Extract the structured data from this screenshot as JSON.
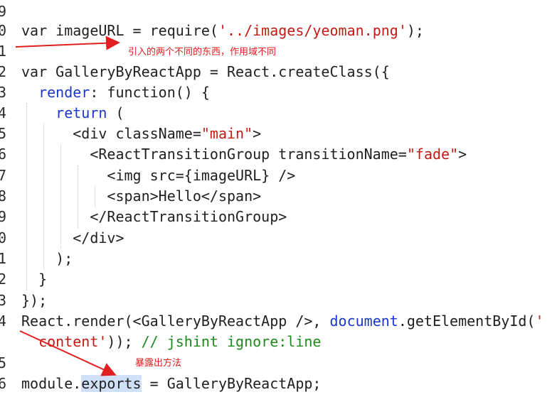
{
  "lines": [
    {
      "num": "9",
      "tokens": []
    },
    {
      "num": "0",
      "tokens": [
        {
          "t": "var imageURL = require(",
          "c": "var"
        },
        {
          "t": "'../images/yeoman.png'",
          "c": "str"
        },
        {
          "t": ");",
          "c": "punct"
        }
      ]
    },
    {
      "num": "1",
      "tokens": []
    },
    {
      "num": "2",
      "tokens": [
        {
          "t": "var GalleryByReactApp = React.createClass({",
          "c": "var"
        }
      ]
    },
    {
      "num": "3",
      "tokens": [
        {
          "t": "  ",
          "c": "var"
        },
        {
          "t": "render",
          "c": "kw-blue"
        },
        {
          "t": ": function() {",
          "c": "var"
        }
      ]
    },
    {
      "num": "4",
      "tokens": [
        {
          "t": "    ",
          "c": "var"
        },
        {
          "t": "return",
          "c": "kw-blue"
        },
        {
          "t": " (",
          "c": "var"
        }
      ]
    },
    {
      "num": "5",
      "tokens": [
        {
          "t": "      <div className=",
          "c": "tag"
        },
        {
          "t": "\"main\"",
          "c": "str"
        },
        {
          "t": ">",
          "c": "tag"
        }
      ]
    },
    {
      "num": "6",
      "tokens": [
        {
          "t": "        <ReactTransitionGroup transitionName=",
          "c": "tag"
        },
        {
          "t": "\"fade\"",
          "c": "str"
        },
        {
          "t": ">",
          "c": "tag"
        }
      ]
    },
    {
      "num": "7",
      "tokens": [
        {
          "t": "          <img src={imageURL} />",
          "c": "tag"
        }
      ]
    },
    {
      "num": "8",
      "tokens": [
        {
          "t": "          <span>Hello</span>",
          "c": "tag"
        }
      ]
    },
    {
      "num": "9",
      "tokens": [
        {
          "t": "        </ReactTransitionGroup>",
          "c": "tag"
        }
      ]
    },
    {
      "num": "0",
      "tokens": [
        {
          "t": "      </div>",
          "c": "tag"
        }
      ]
    },
    {
      "num": "1",
      "tokens": [
        {
          "t": "    );",
          "c": "var"
        }
      ]
    },
    {
      "num": "2",
      "tokens": [
        {
          "t": "  }",
          "c": "var"
        }
      ]
    },
    {
      "num": "3",
      "tokens": [
        {
          "t": "});",
          "c": "var"
        }
      ]
    },
    {
      "num": "4",
      "tokens": [
        {
          "t": "React.render(<GalleryByReactApp />, ",
          "c": "var"
        },
        {
          "t": "document",
          "c": "kw-blue"
        },
        {
          "t": ".getElementById(",
          "c": "var"
        },
        {
          "t": "'",
          "c": "str"
        }
      ]
    },
    {
      "num": "",
      "tokens": [
        {
          "t": "  ",
          "c": "var"
        },
        {
          "t": "content'",
          "c": "str"
        },
        {
          "t": ")); ",
          "c": "var"
        },
        {
          "t": "// jshint ignore:line",
          "c": "cm"
        }
      ]
    },
    {
      "num": "5",
      "tokens": []
    },
    {
      "num": "6",
      "tokens": [
        {
          "t": "module.",
          "c": "var"
        },
        {
          "t": "exports",
          "c": "sel"
        },
        {
          "t": " = GalleryByReactApp;",
          "c": "var"
        }
      ]
    }
  ],
  "annotations": {
    "note1": "引入的两个不同的东西，作用域不同",
    "note2": "暴露出方法"
  },
  "colors": {
    "annotation": "#e02020",
    "string": "#c41a16",
    "keyword": "#1b36c9",
    "comment": "#1d8a1d",
    "selection": "#cfe0f7"
  }
}
